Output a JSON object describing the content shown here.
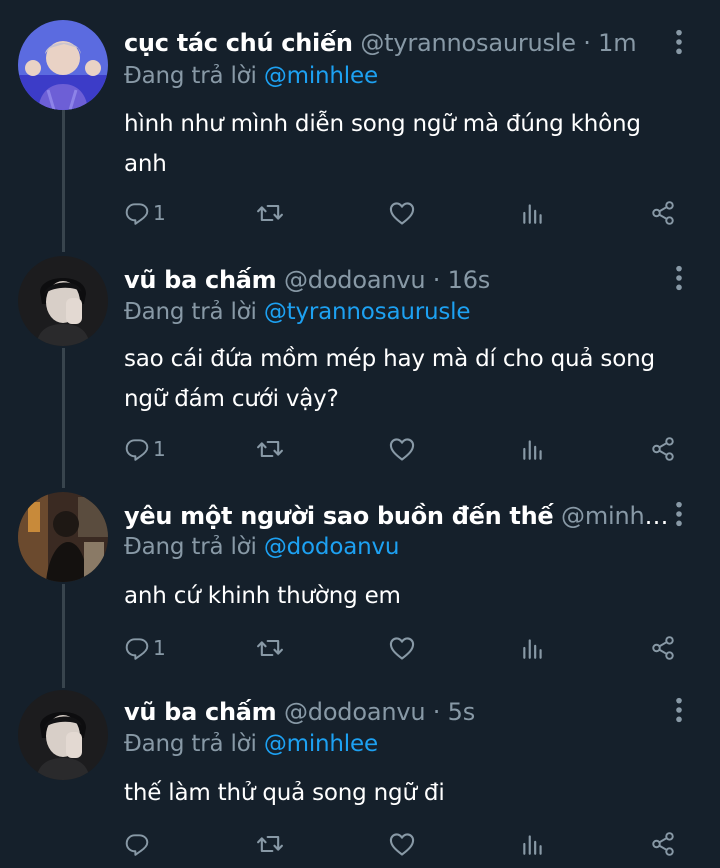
{
  "tweets": [
    {
      "name": "cục tác chú chiến",
      "handle": "@tyrannosaurusle · 1m",
      "replying_prefix": "Đang trả lời ",
      "replying_to": "@minhlee",
      "text_line1": "hình như mình diễn song ngữ mà đúng không",
      "text_line2": "anh",
      "reply_count": "1",
      "avatar_icon": "avatar-photo"
    },
    {
      "name": "vũ ba chấm",
      "handle": "@dodoanvu · 16s",
      "replying_prefix": "Đang trả lời ",
      "replying_to": "@tyrannosaurusle",
      "text_line1": "sao cái đứa mồm mép hay mà dí cho quả song",
      "text_line2": "ngữ đám cưới vậy?",
      "reply_count": "1",
      "avatar_icon": "avatar-photo"
    },
    {
      "name": "yêu một người sao buồn đến thế",
      "handle": "@minhlee ·...",
      "replying_prefix": "Đang trả lời ",
      "replying_to": "@dodoanvu",
      "text_line1": "anh cứ khinh thường em",
      "reply_count": "1",
      "avatar_icon": "avatar-photo"
    },
    {
      "name": "vũ ba chấm",
      "handle": "@dodoanvu · 5s",
      "replying_prefix": "Đang trả lời ",
      "replying_to": "@minhlee",
      "text_line1": "thế làm thử quả song ngữ đi",
      "reply_count": "",
      "avatar_icon": "avatar-photo"
    }
  ],
  "colors": {
    "background": "#15202b",
    "muted": "#8899a6",
    "accent": "#1da1f2",
    "thread_line": "#38444d"
  },
  "icons": [
    "reply-icon",
    "retweet-icon",
    "like-icon",
    "analytics-icon",
    "share-icon",
    "more-icon"
  ]
}
